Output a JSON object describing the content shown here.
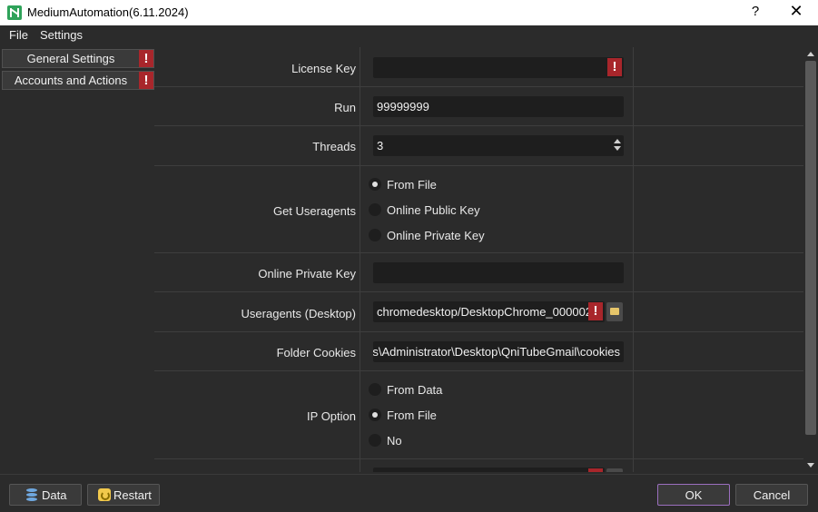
{
  "window": {
    "title": "MediumAutomation(6.11.2024)",
    "help": "?",
    "close": "✕"
  },
  "menu": {
    "file": "File",
    "settings": "Settings"
  },
  "sidebar": {
    "items": [
      {
        "label": "General Settings",
        "warning": "!"
      },
      {
        "label": "Accounts and Actions",
        "warning": "!"
      }
    ]
  },
  "settings": {
    "license_key": {
      "label": "License Key",
      "value": "",
      "warning": "!"
    },
    "run": {
      "label": "Run",
      "value": "99999999"
    },
    "threads": {
      "label": "Threads",
      "value": "3"
    },
    "get_useragents": {
      "label": "Get Useragents",
      "options": [
        "From File",
        "Online Public Key",
        "Online Private Key"
      ],
      "selected": "From File"
    },
    "online_private_key": {
      "label": "Online Private Key",
      "value": ""
    },
    "useragents_desktop": {
      "label": "Useragents (Desktop)",
      "value": "chromedesktop/DesktopChrome_000002.",
      "warning": "!"
    },
    "folder_cookies": {
      "label": "Folder Cookies",
      "value": "s\\Administrator\\Desktop\\QniTubeGmail\\cookies"
    },
    "ip_option": {
      "label": "IP Option",
      "options": [
        "From Data",
        "From File",
        "No"
      ],
      "selected": "From File"
    },
    "partial_row": {
      "warning": "!"
    }
  },
  "footer": {
    "data_btn": "Data",
    "restart_btn": "Restart",
    "ok_btn": "OK",
    "cancel_btn": "Cancel"
  },
  "colors": {
    "accent_border": "#9b6fbf",
    "warning": "#a8262b",
    "background": "#2b2b2b",
    "field": "#1e1e1e"
  }
}
